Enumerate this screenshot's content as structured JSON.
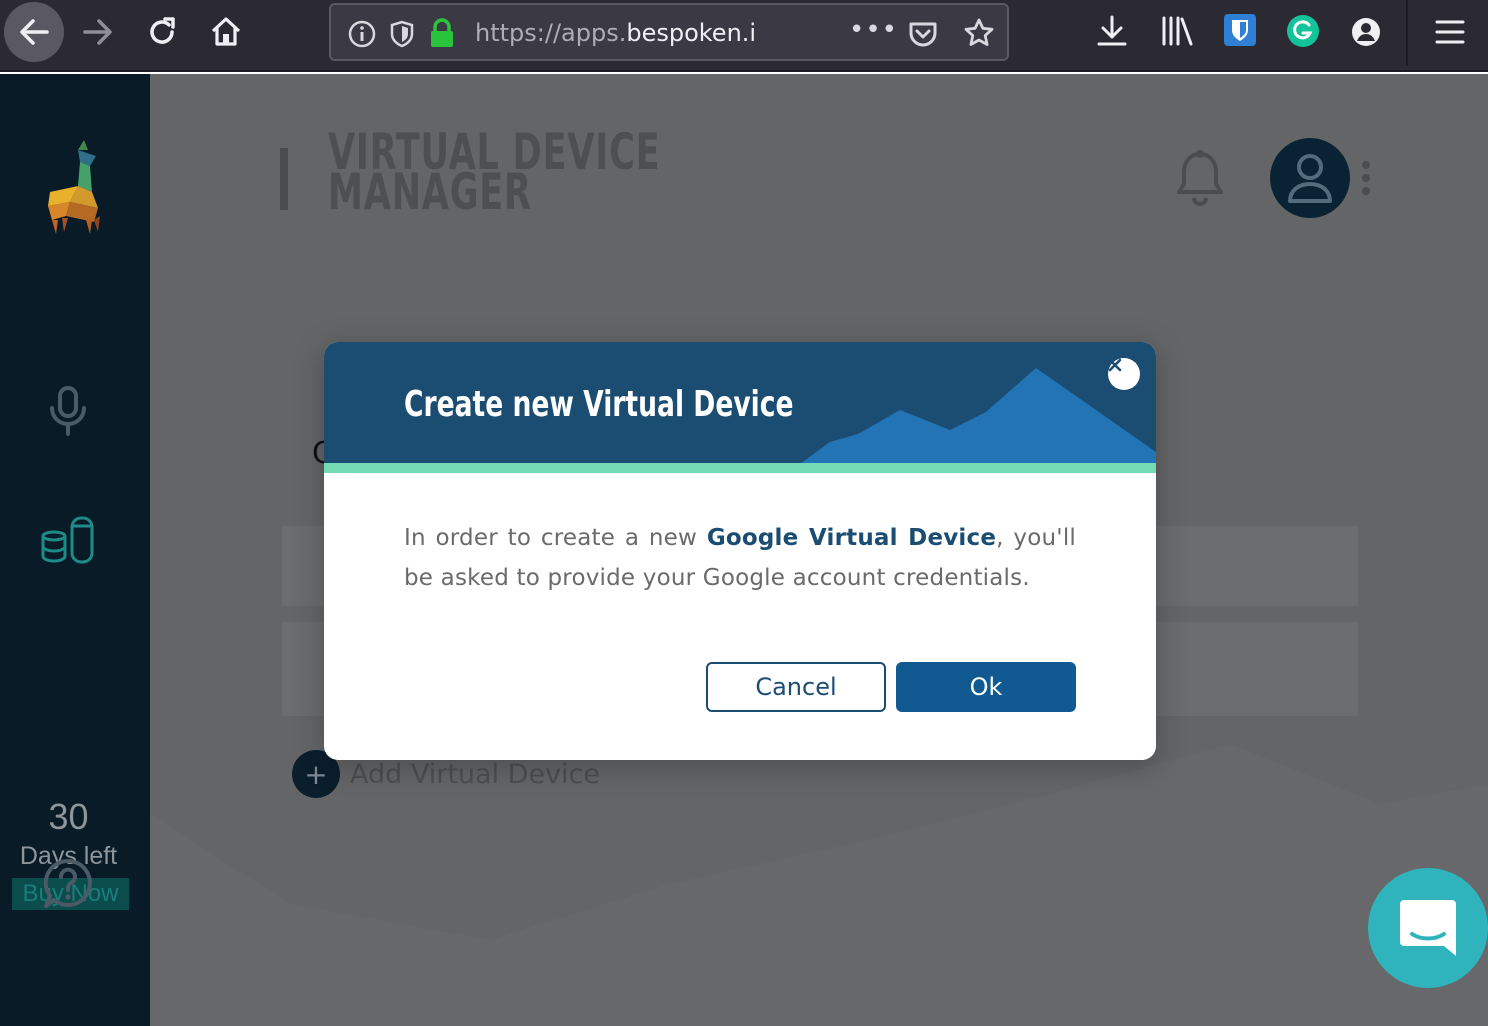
{
  "browser": {
    "url_prefix": "https://apps.",
    "url_host": "bespoken.i",
    "url_more": "•••"
  },
  "sidebar": {
    "trial_days": "30",
    "trial_label": "Days left",
    "buy_now": "Buy Now"
  },
  "header": {
    "title_line1": "VIRTUAL DEVICE",
    "title_line2": "MANAGER"
  },
  "main": {
    "partial_letter": "C",
    "add_button_symbol": "+",
    "add_device_label": "Add Virtual Device"
  },
  "modal": {
    "title": "Create new Virtual Device",
    "body_before": "In order to create a new ",
    "body_strong": "Google Virtual Device",
    "body_after": ", you'll be asked to provide your Google account credentials.",
    "cancel_label": "Cancel",
    "ok_label": "Ok"
  },
  "colors": {
    "toolbar_bg": "#2b2a33",
    "sidebar_bg": "#081b27",
    "modal_header": "#1b4d72",
    "modal_accent": "#73dab5",
    "ok_button": "#115a91",
    "chat_launcher": "#2fb4bd"
  },
  "icons": {
    "back": "arrow-left-icon",
    "forward": "arrow-right-icon",
    "reload": "reload-icon",
    "home": "home-icon",
    "info": "info-icon",
    "tracking": "shield-icon",
    "lock": "lock-icon",
    "pocket": "pocket-icon",
    "bookmark": "star-icon",
    "download": "download-icon",
    "library": "library-icon",
    "bitwarden": "bitwarden-icon",
    "grammarly": "grammarly-icon",
    "account": "account-icon",
    "menu": "hamburger-menu-icon",
    "logo": "llama-logo-icon",
    "mic": "microphone-icon",
    "devices": "devices-icon",
    "help": "help-icon",
    "bell": "bell-icon",
    "user": "user-icon",
    "kebab": "kebab-menu-icon",
    "close": "close-icon",
    "chat": "chat-icon"
  }
}
